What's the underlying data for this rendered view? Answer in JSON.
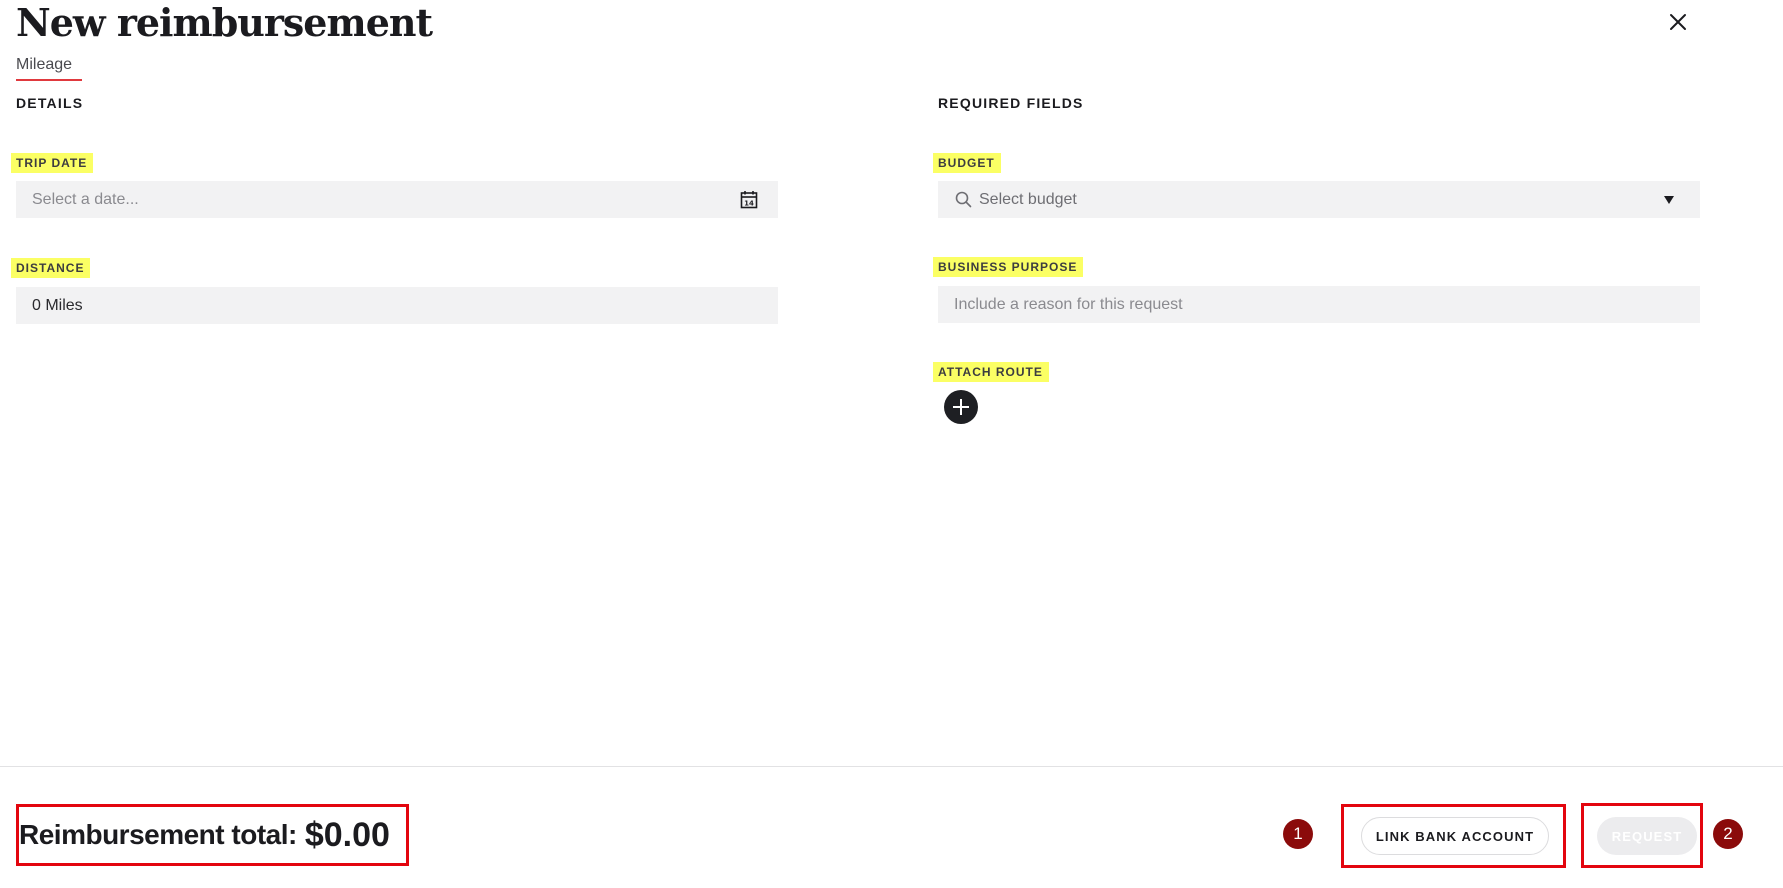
{
  "header": {
    "title": "New reimbursement"
  },
  "tabs": [
    {
      "label": "Mileage",
      "active": true
    }
  ],
  "details": {
    "section_title": "DETAILS",
    "trip_date": {
      "label": "TRIP DATE",
      "placeholder": "Select a date..."
    },
    "distance": {
      "label": "DISTANCE",
      "value": "0 Miles"
    }
  },
  "required": {
    "section_title": "REQUIRED FIELDS",
    "budget": {
      "label": "BUDGET",
      "placeholder": "Select budget"
    },
    "business_purpose": {
      "label": "BUSINESS PURPOSE",
      "placeholder": "Include a reason for this request"
    },
    "attach_route": {
      "label": "ATTACH ROUTE"
    }
  },
  "footer": {
    "total_label": "Reimbursement total:",
    "total_amount": "$0.00",
    "link_bank_label": "LINK BANK ACCOUNT",
    "request_label": "REQUEST",
    "marker_1": "1",
    "marker_2": "2"
  },
  "icons": {
    "close": "close-icon",
    "calendar": "calendar-icon",
    "search": "search-icon",
    "dropdown": "triangle-down-icon",
    "add": "plus-icon"
  },
  "colors": {
    "highlight": "#fbff64",
    "annotation_red": "#e3050e",
    "marker": "#8b0b0b",
    "tab_underline": "#e0393e"
  }
}
